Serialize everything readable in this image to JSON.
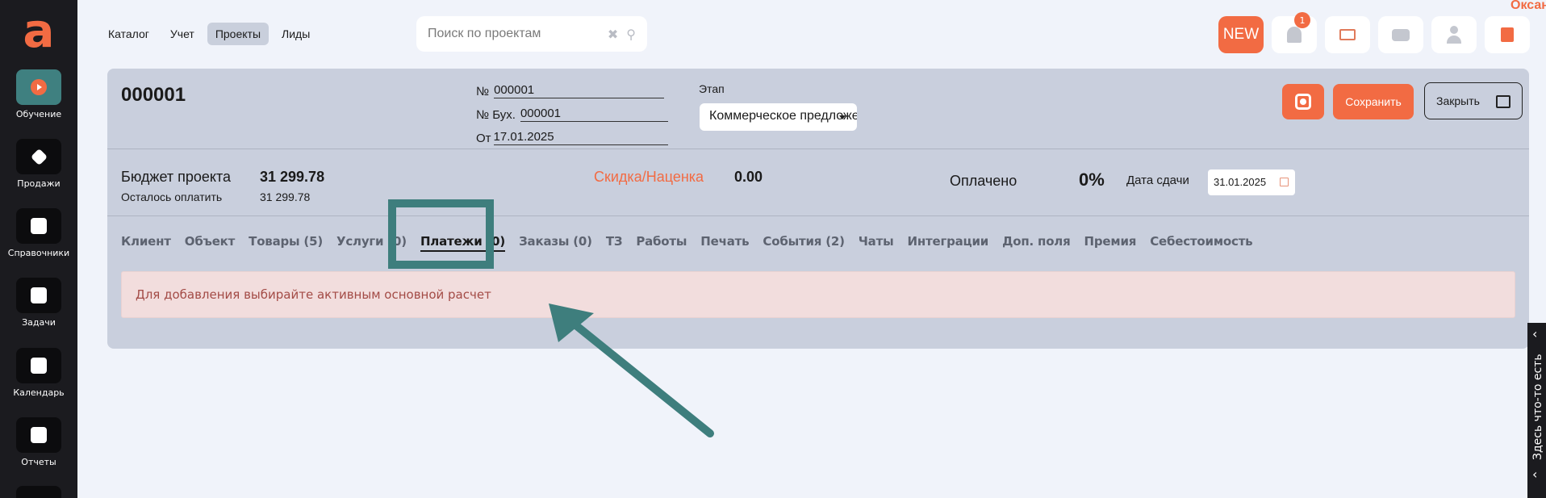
{
  "brand": {
    "logo_letter": "a"
  },
  "sidebar": {
    "items": [
      {
        "label": "Обучение",
        "icon": "play-icon",
        "active": true
      },
      {
        "label": "Продажи",
        "icon": "tag-icon"
      },
      {
        "label": "Справочники",
        "icon": "book-icon"
      },
      {
        "label": "Задачи",
        "icon": "tasks-icon"
      },
      {
        "label": "Календарь",
        "icon": "calendar-icon"
      },
      {
        "label": "Отчеты",
        "icon": "chart-icon"
      }
    ]
  },
  "topnav": {
    "items": [
      {
        "label": "Каталог"
      },
      {
        "label": "Учет"
      },
      {
        "label": "Проекты",
        "active": true
      },
      {
        "label": "Лиды"
      }
    ]
  },
  "search": {
    "placeholder": "Поиск по проектам",
    "value": ""
  },
  "header": {
    "new_label": "NEW",
    "notifications_count": "1",
    "user_name": "Оксана"
  },
  "project": {
    "title": "000001",
    "number_label": "№",
    "number": "000001",
    "acc_label": "№ Бух.",
    "acc_number": "000001",
    "date_label": "От",
    "date": "17.01.2025",
    "stage_label": "Этап",
    "stage_value": "Коммерческое предложение",
    "save_label": "Сохранить",
    "close_label": "Закрыть"
  },
  "budget": {
    "budget_label": "Бюджет проекта",
    "budget_value": "31 299.78",
    "left_label": "Осталось оплатить",
    "left_value": "31 299.78",
    "discount_label": "Скидка/Наценка",
    "discount_value": "0.00",
    "paid_label": "Оплачено",
    "paid_value": "0%",
    "due_label": "Дата сдачи",
    "due_value": "31.01.2025"
  },
  "tabs": [
    {
      "label": "Клиент"
    },
    {
      "label": "Объект"
    },
    {
      "label": "Товары (5)"
    },
    {
      "label": "Услуги (0)"
    },
    {
      "label": "Платежи (0)",
      "active": true
    },
    {
      "label": "Заказы (0)"
    },
    {
      "label": "ТЗ"
    },
    {
      "label": "Работы"
    },
    {
      "label": "Печать"
    },
    {
      "label": "События (2)"
    },
    {
      "label": "Чаты"
    },
    {
      "label": "Интеграции"
    },
    {
      "label": "Доп. поля"
    },
    {
      "label": "Премия"
    },
    {
      "label": "Себестоимость"
    }
  ],
  "alert": {
    "text": "Для добавления выбирайте активным основной расчет"
  },
  "edge_panel": {
    "text": "Здесь что-то есть"
  },
  "colors": {
    "accent": "#f26b43",
    "sidebar": "#1b1b1f",
    "highlight": "#3e7e7d",
    "card": "#c9cfdd"
  }
}
